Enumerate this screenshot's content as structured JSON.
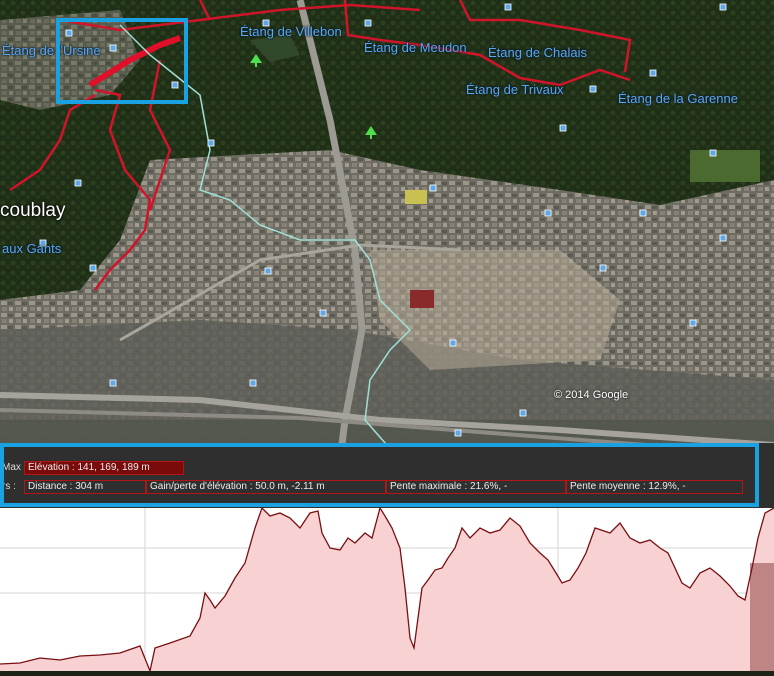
{
  "map": {
    "labels": {
      "etang_ursine": "Étang de l'Ursine",
      "etang_villebon": "Étang de Villebon",
      "etang_meudon": "Étang de Meudon",
      "etang_chalais": "Étang de Chalais",
      "etang_trivaux": "Étang de Trivaux",
      "etang_garenne": "Étang de la Garenne",
      "town_coublay": "coublay",
      "aux_gants": "aux Gants"
    },
    "copyright": "© 2014 Google"
  },
  "elevation_panel": {
    "row1_label": "Max",
    "row2_label": "rs :",
    "elevation": "Élévation : 141, 169, 189 m",
    "distance": "Distance : 304 m",
    "gain_loss": "Gain/perte d'élévation : 50.0 m, -2.11 m",
    "max_slope": "Pente maximale : 21.6%, -",
    "avg_slope": "Pente moyenne : 12.9%, -"
  },
  "colors": {
    "highlight": "#1aa1e2",
    "route": "#d0142a",
    "profile_line": "#7a0f12",
    "profile_fill": "#f7d3d3"
  }
}
